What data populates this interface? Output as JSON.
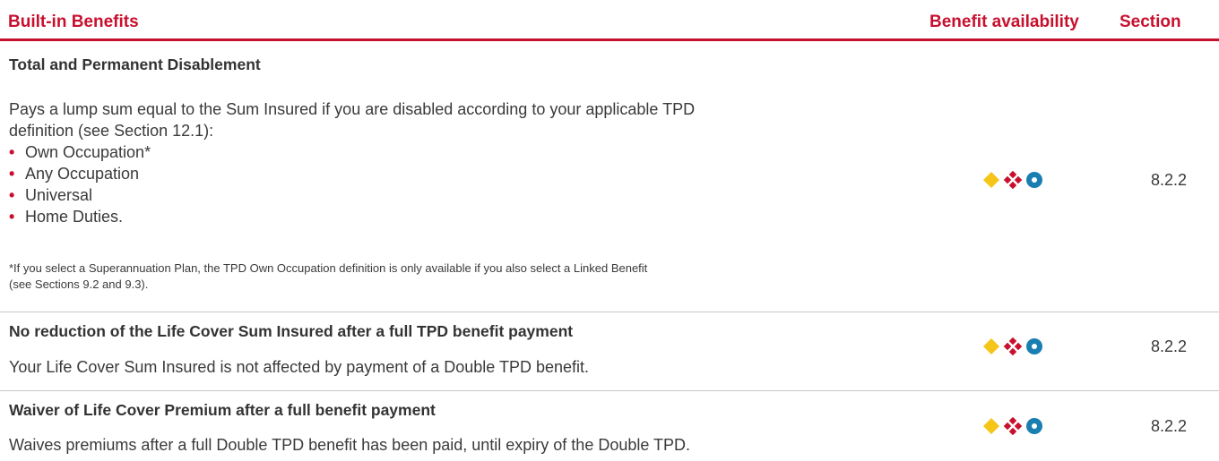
{
  "colors": {
    "accent": "#c8102e",
    "gold": "#f5c518",
    "blue": "#1a7fb0"
  },
  "header": {
    "title": "Built-in Benefits",
    "availability": "Benefit availability",
    "section": "Section"
  },
  "rows": [
    {
      "title": "Total and Permanent Disablement",
      "description_line1": "Pays a lump sum equal to the Sum Insured if you are disabled according to your applicable TPD",
      "description_line2": "definition (see Section 12.1):",
      "bullets": [
        "Own Occupation*",
        "Any Occupation",
        "Universal",
        "Home Duties."
      ],
      "footnote_line1": "*If you select a Superannuation Plan, the TPD Own Occupation definition is only available if you also select a Linked Benefit",
      "footnote_line2": "(see Sections 9.2 and 9.3).",
      "availability_icons": [
        "diamond-icon",
        "clover-icon",
        "circle-dot-icon"
      ],
      "section": "8.2.2"
    },
    {
      "title": "No reduction of the Life Cover Sum Insured after a full TPD benefit payment",
      "description": "Your Life Cover Sum Insured is not affected by payment of a Double TPD benefit.",
      "availability_icons": [
        "diamond-icon",
        "clover-icon",
        "circle-dot-icon"
      ],
      "section": "8.2.2"
    },
    {
      "title": "Waiver of Life Cover Premium after a full benefit payment",
      "description": "Waives premiums after a full Double TPD benefit has been paid, until expiry of the Double TPD.",
      "availability_icons": [
        "diamond-icon",
        "clover-icon",
        "circle-dot-icon"
      ],
      "section": "8.2.2"
    }
  ]
}
